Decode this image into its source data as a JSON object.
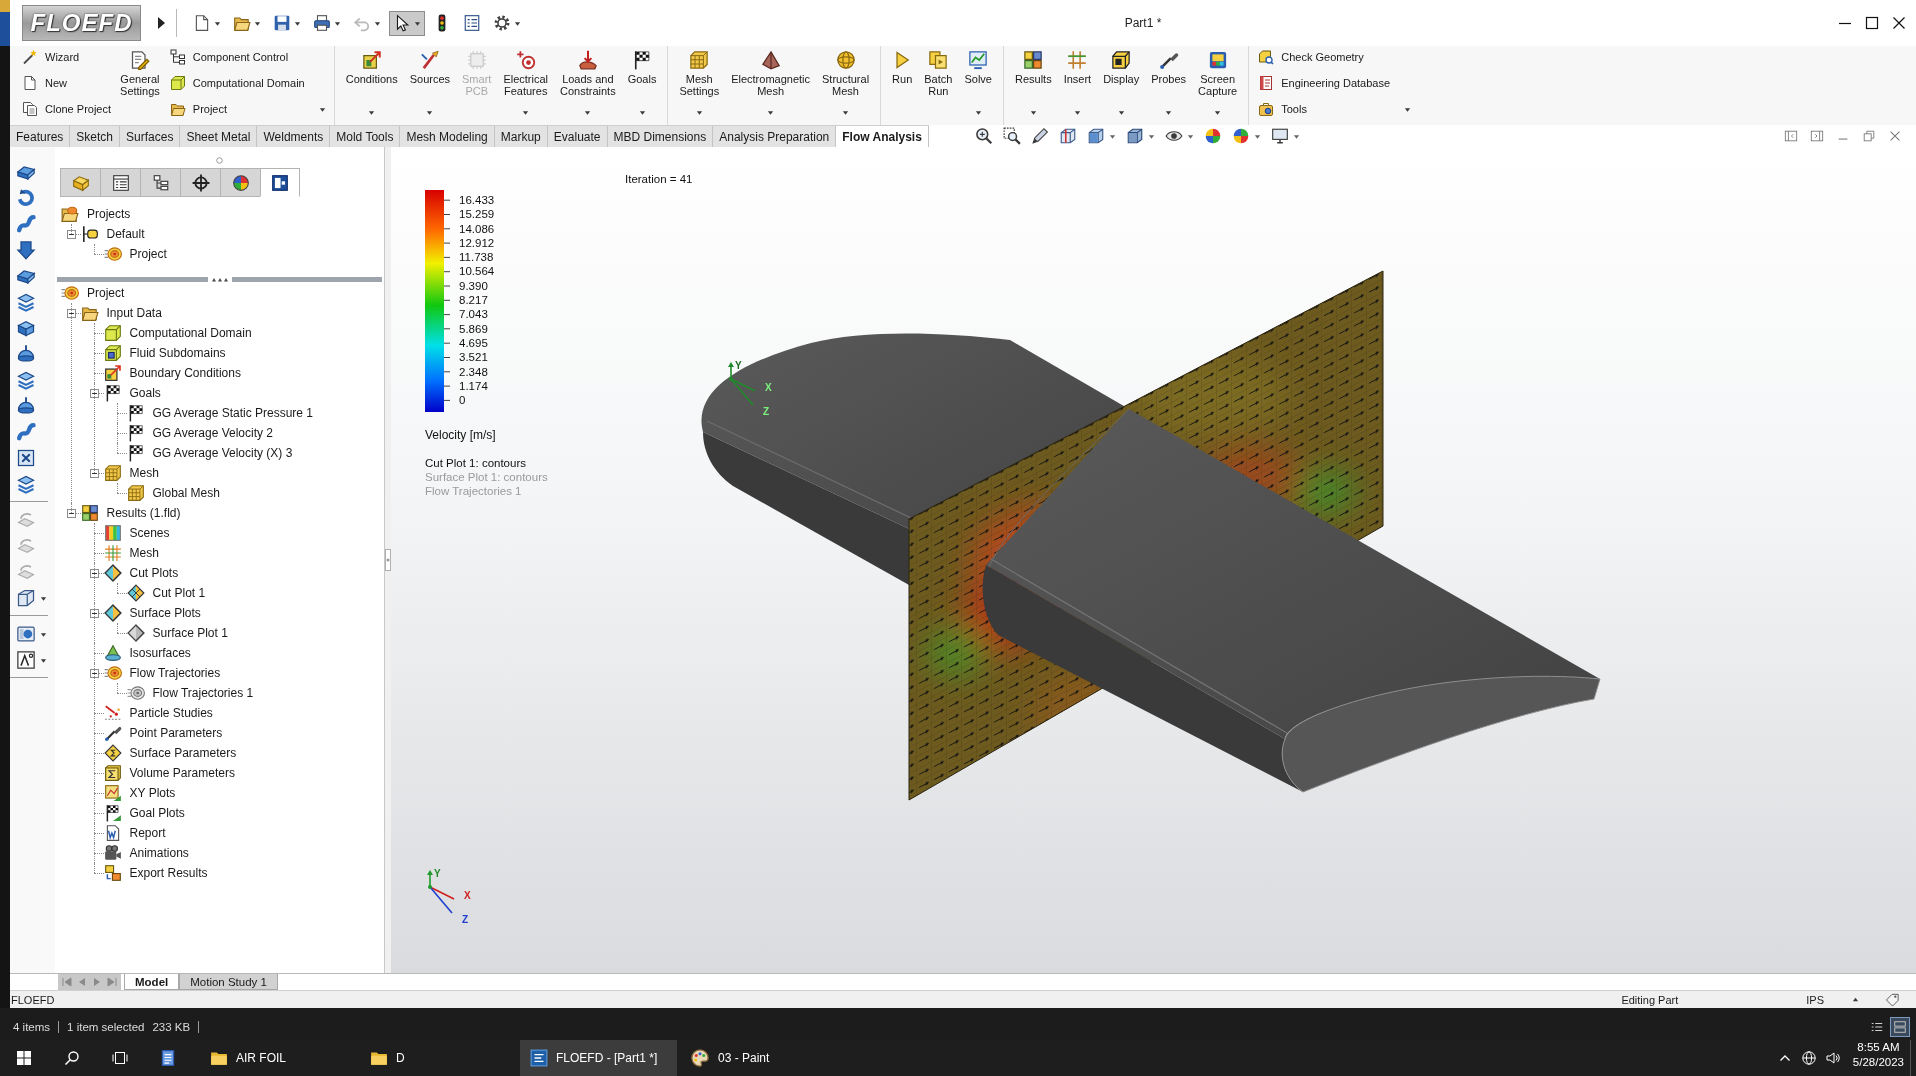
{
  "title_bar": {
    "logo": "FLOEFD",
    "title": "Part1 *",
    "quick_access": [
      {
        "dropdown": true,
        "disabled": false,
        "pressed": false
      },
      {
        "dropdown": true,
        "disabled": false,
        "pressed": false
      },
      {
        "dropdown": true,
        "disabled": false,
        "pressed": false
      },
      {
        "dropdown": true,
        "disabled": false,
        "pressed": false
      },
      {
        "dropdown": true,
        "disabled": true,
        "pressed": false
      },
      {
        "dropdown": true,
        "disabled": false,
        "pressed": true
      },
      {
        "dropdown": false,
        "disabled": false,
        "pressed": false
      },
      {
        "dropdown": false,
        "disabled": false,
        "pressed": false
      },
      {
        "dropdown": true,
        "disabled": false,
        "pressed": false
      }
    ]
  },
  "ribbon": {
    "groups": [
      {
        "items": [
          {
            "kind": "stack",
            "items": [
              {
                "label": "Wizard",
                "dropdown": false
              },
              {
                "label": "New",
                "dropdown": false
              },
              {
                "label": "Clone Project",
                "dropdown": false
              }
            ]
          },
          {
            "kind": "large",
            "lines": [
              "General",
              "Settings"
            ],
            "dropdown": false,
            "disabled": false
          },
          {
            "kind": "stack",
            "items": [
              {
                "label": "Component Control",
                "dropdown": false
              },
              {
                "label": "Computational Domain",
                "dropdown": false
              },
              {
                "label": "Project",
                "dropdown": true
              }
            ]
          }
        ]
      },
      {
        "items": [
          {
            "kind": "large",
            "lines": [
              "Conditions"
            ],
            "dropdown": true,
            "disabled": false
          },
          {
            "kind": "large",
            "lines": [
              "Sources"
            ],
            "dropdown": true,
            "disabled": false
          },
          {
            "kind": "large",
            "lines": [
              "Smart",
              "PCB"
            ],
            "dropdown": false,
            "disabled": true
          },
          {
            "kind": "large",
            "lines": [
              "Electrical",
              "Features"
            ],
            "dropdown": true,
            "disabled": false
          },
          {
            "kind": "large",
            "lines": [
              "Loads and",
              "Constraints"
            ],
            "dropdown": true,
            "disabled": false
          },
          {
            "kind": "large",
            "lines": [
              "Goals"
            ],
            "dropdown": true,
            "disabled": false
          }
        ]
      },
      {
        "items": [
          {
            "kind": "large",
            "lines": [
              "Mesh",
              "Settings"
            ],
            "dropdown": true,
            "disabled": false
          },
          {
            "kind": "large",
            "lines": [
              "Electromagnetic",
              "Mesh"
            ],
            "dropdown": true,
            "disabled": false
          },
          {
            "kind": "large",
            "lines": [
              "Structural",
              "Mesh"
            ],
            "dropdown": true,
            "disabled": false
          }
        ]
      },
      {
        "items": [
          {
            "kind": "large",
            "lines": [
              "Run"
            ],
            "dropdown": false,
            "disabled": false
          },
          {
            "kind": "large",
            "lines": [
              "Batch",
              "Run"
            ],
            "dropdown": false,
            "disabled": false
          },
          {
            "kind": "large",
            "lines": [
              "Solve"
            ],
            "dropdown": true,
            "disabled": false
          }
        ]
      },
      {
        "items": [
          {
            "kind": "large",
            "lines": [
              "Results"
            ],
            "dropdown": true,
            "disabled": false
          },
          {
            "kind": "large",
            "lines": [
              "Insert"
            ],
            "dropdown": true,
            "disabled": false
          },
          {
            "kind": "large",
            "lines": [
              "Display"
            ],
            "dropdown": true,
            "disabled": false
          },
          {
            "kind": "large",
            "lines": [
              "Probes"
            ],
            "dropdown": true,
            "disabled": false
          },
          {
            "kind": "large",
            "lines": [
              "Screen",
              "Capture"
            ],
            "dropdown": true,
            "disabled": false
          }
        ]
      },
      {
        "items": [
          {
            "kind": "stack",
            "items": [
              {
                "label": "Check Geometry",
                "dropdown": false
              },
              {
                "label": "Engineering Database",
                "dropdown": false
              },
              {
                "label": "Tools",
                "dropdown": true
              }
            ]
          }
        ]
      }
    ]
  },
  "tabs": [
    {
      "label": "Features",
      "selected": false
    },
    {
      "label": "Sketch",
      "selected": false
    },
    {
      "label": "Surfaces",
      "selected": false
    },
    {
      "label": "Sheet Metal",
      "selected": false
    },
    {
      "label": "Weldments",
      "selected": false
    },
    {
      "label": "Mold Tools",
      "selected": false
    },
    {
      "label": "Mesh Modeling",
      "selected": false
    },
    {
      "label": "Markup",
      "selected": false
    },
    {
      "label": "Evaluate",
      "selected": false
    },
    {
      "label": "MBD Dimensions",
      "selected": false
    },
    {
      "label": "Analysis Preparation",
      "selected": false
    },
    {
      "label": "Flow Analysis",
      "selected": true
    }
  ],
  "view_toolbar": [
    {
      "dropdown": false
    },
    {
      "dropdown": false
    },
    {
      "dropdown": false
    },
    {
      "dropdown": false
    },
    {
      "dropdown": true
    },
    {
      "dropdown": true
    },
    {
      "dropdown": true
    },
    {
      "dropdown": false
    },
    {
      "dropdown": true
    },
    {
      "dropdown": true
    }
  ],
  "feature_toolbar": [
    [
      {
        "disabled": false,
        "dropdown": false
      },
      {
        "disabled": false,
        "dropdown": false
      },
      {
        "disabled": false,
        "dropdown": false
      },
      {
        "disabled": false,
        "dropdown": false
      },
      {
        "disabled": false,
        "dropdown": false
      },
      {
        "disabled": false,
        "dropdown": false
      },
      {
        "disabled": false,
        "dropdown": false
      },
      {
        "disabled": false,
        "dropdown": false
      },
      {
        "disabled": false,
        "dropdown": false
      },
      {
        "disabled": false,
        "dropdown": false
      },
      {
        "disabled": false,
        "dropdown": false
      },
      {
        "disabled": false,
        "dropdown": false
      },
      {
        "disabled": false,
        "dropdown": false
      }
    ],
    [
      {
        "disabled": true,
        "dropdown": false
      },
      {
        "disabled": true,
        "dropdown": false
      },
      {
        "disabled": true,
        "dropdown": false
      },
      {
        "disabled": false,
        "dropdown": true
      }
    ],
    [
      {
        "disabled": false,
        "dropdown": true
      },
      {
        "disabled": false,
        "dropdown": true
      }
    ]
  ],
  "panel_tabs": [
    {
      "selected": false
    },
    {
      "selected": false
    },
    {
      "selected": false
    },
    {
      "selected": false
    },
    {
      "selected": false
    },
    {
      "selected": true
    }
  ],
  "project_tree": {
    "label": "Projects",
    "children": [
      {
        "label": "Default",
        "expanded": true,
        "children": [
          {
            "label": "Project"
          }
        ]
      }
    ]
  },
  "analysis_tree": {
    "label": "Project",
    "children": [
      {
        "label": "Input Data",
        "expanded": true,
        "children": [
          {
            "label": "Computational Domain"
          },
          {
            "label": "Fluid Subdomains"
          },
          {
            "label": "Boundary Conditions"
          },
          {
            "label": "Goals",
            "expanded": true,
            "children": [
              {
                "label": "GG Average Static Pressure 1"
              },
              {
                "label": "GG Average Velocity 2"
              },
              {
                "label": "GG Average Velocity (X) 3"
              }
            ]
          },
          {
            "label": "Mesh",
            "expanded": true,
            "children": [
              {
                "label": "Global Mesh"
              }
            ]
          }
        ]
      },
      {
        "label": "Results (1.fld)",
        "expanded": true,
        "children": [
          {
            "label": "Scenes"
          },
          {
            "label": "Mesh"
          },
          {
            "label": "Cut Plots",
            "expanded": true,
            "children": [
              {
                "label": "Cut Plot 1"
              }
            ]
          },
          {
            "label": "Surface Plots",
            "expanded": true,
            "children": [
              {
                "label": "Surface Plot 1"
              }
            ]
          },
          {
            "label": "Isosurfaces"
          },
          {
            "label": "Flow Trajectories",
            "expanded": true,
            "children": [
              {
                "label": "Flow Trajectories 1"
              }
            ]
          },
          {
            "label": "Particle Studies"
          },
          {
            "label": "Point Parameters"
          },
          {
            "label": "Surface Parameters"
          },
          {
            "label": "Volume Parameters"
          },
          {
            "label": "XY Plots"
          },
          {
            "label": "Goal Plots"
          },
          {
            "label": "Report"
          },
          {
            "label": "Animations"
          },
          {
            "label": "Export Results"
          }
        ]
      }
    ]
  },
  "viewport": {
    "iteration": "Iteration = 41",
    "legend": {
      "values": [
        "16.433",
        "15.259",
        "14.086",
        "12.912",
        "11.738",
        "10.564",
        "9.390",
        "8.217",
        "7.043",
        "5.869",
        "4.695",
        "3.521",
        "2.348",
        "1.174",
        "0"
      ],
      "title": "Velocity [m/s]"
    },
    "plots": [
      {
        "label": "Cut Plot 1: contours",
        "visible": true
      },
      {
        "label": "Surface Plot 1: contours",
        "visible": false
      },
      {
        "label": "Flow Trajectories 1",
        "visible": false
      }
    ],
    "model_axes": {
      "x": "X",
      "y": "Y",
      "z": "Z"
    },
    "view_axes": {
      "x": "X",
      "y": "Y",
      "z": "Z"
    }
  },
  "model_tabs": [
    {
      "label": "Model",
      "selected": true
    },
    {
      "label": "Motion Study 1",
      "selected": false
    }
  ],
  "status_bar": {
    "app": "FLOEFD",
    "mode": "Editing Part",
    "units": "IPS"
  },
  "explorer_status": {
    "count": "4 items",
    "selection": "1 item selected",
    "size": "233 KB",
    "view_buttons": [
      {
        "selected": false
      },
      {
        "selected": true
      }
    ]
  },
  "taskbar": {
    "items": [
      {
        "kind": "folder",
        "label": "AIR FOIL",
        "selected": false
      },
      {
        "kind": "folder",
        "label": "D",
        "selected": false
      },
      {
        "kind": "app",
        "label": "FLOEFD - [Part1 *]",
        "selected": true
      },
      {
        "kind": "paint",
        "label": "03 - Paint",
        "selected": false
      }
    ],
    "time": "8:55 AM",
    "date": "5/28/2023"
  }
}
